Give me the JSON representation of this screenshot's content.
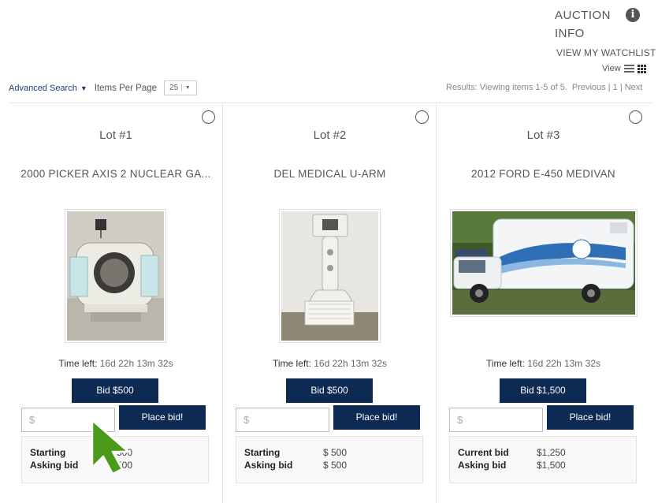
{
  "header": {
    "auction_info": "AUCTION INFO",
    "watchlist": "VIEW MY WATCHLIST",
    "view_label": "View"
  },
  "toolbar": {
    "advanced_search": "Advanced Search",
    "items_per_page_label": "Items Per Page",
    "items_per_page_value": "25",
    "results_text": "Results: Viewing items 1-5 of 5.",
    "pagination": "Previous | 1 | Next"
  },
  "lots": [
    {
      "lot": "Lot #1",
      "title": "2000 PICKER AXIS 2 NUCLEAR GA...",
      "time_label": "Time left:",
      "time_value": "16d 22h 13m 32s",
      "bid_button": "Bid $500",
      "input_placeholder": "$",
      "place_bid": "Place bid!",
      "row1_label": "Starting",
      "row1_value": "$ 500",
      "row2_label": "Asking bid",
      "row2_value": "$ 500"
    },
    {
      "lot": "Lot #2",
      "title": "DEL MEDICAL U-ARM",
      "time_label": "Time left:",
      "time_value": "16d 22h 13m 32s",
      "bid_button": "Bid $500",
      "input_placeholder": "$",
      "place_bid": "Place bid!",
      "row1_label": "Starting",
      "row1_value": "$ 500",
      "row2_label": "Asking bid",
      "row2_value": "$ 500"
    },
    {
      "lot": "Lot #3",
      "title": "2012 FORD E-450 MEDIVAN",
      "time_label": "Time left:",
      "time_value": "16d 22h 13m 32s",
      "bid_button": "Bid $1,500",
      "input_placeholder": "$",
      "place_bid": "Place bid!",
      "row1_label": "Current bid",
      "row1_value": "$1,250",
      "row2_label": "Asking bid",
      "row2_value": "$1,500"
    }
  ],
  "colors": {
    "button_navy": "#0d2a55",
    "cursor_green": "#4c9a1a"
  }
}
